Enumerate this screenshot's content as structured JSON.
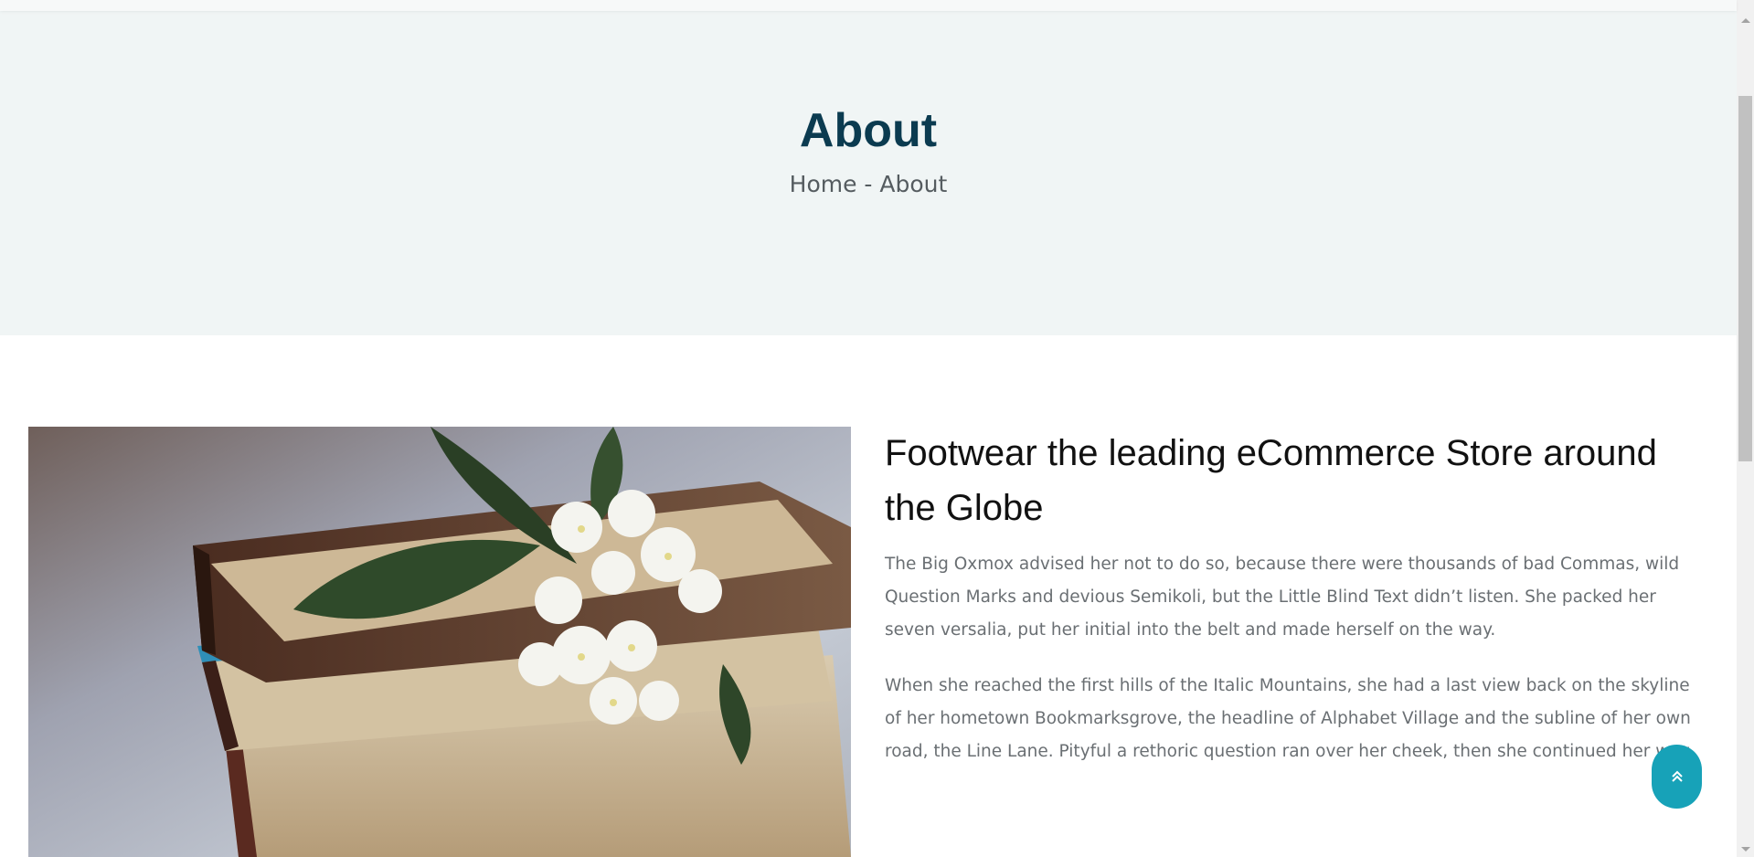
{
  "hero": {
    "title": "About",
    "breadcrumb": {
      "home": "Home",
      "separator": " - ",
      "current": "About"
    }
  },
  "about": {
    "image_icon": "stack-of-books-with-flowers-photo",
    "headline": "Footwear the leading eCommerce Store around the Globe",
    "paragraphs": [
      "The Big Oxmox advised her not to do so, because there were thousands of bad Commas, wild Question Marks and devious Semikoli, but the Little Blind Text didn’t listen. She packed her seven versalia, put her initial into the belt and made herself on the way.",
      "When she reached the first hills of the Italic Mountains, she had a last view back on the skyline of her hometown Bookmarksgrove, the headline of Alphabet Village and the subline of her own road, the Line Lane. Pityful a rethoric question ran over her cheek, then she continued her way."
    ]
  },
  "back_to_top": {
    "icon": "double-chevron-up-icon"
  },
  "colors": {
    "hero_bg": "#f0f5f5",
    "title": "#0b3b50",
    "accent": "#17a2b8",
    "body_text": "#6a6f73"
  }
}
